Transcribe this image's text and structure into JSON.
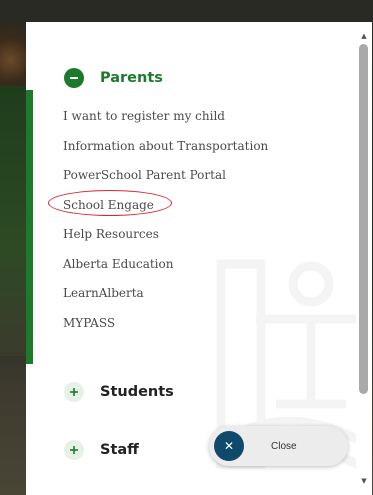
{
  "menu": {
    "parents": {
      "title": "Parents",
      "toggle_icon": "minus-circle-icon",
      "items": [
        {
          "label": "I want to register my child"
        },
        {
          "label": "Information about Transportation"
        },
        {
          "label": "PowerSchool Parent Portal"
        },
        {
          "label": "School Engage",
          "circled": true
        },
        {
          "label": "Help Resources"
        },
        {
          "label": "Alberta Education"
        },
        {
          "label": "LearnAlberta"
        },
        {
          "label": "MYPASS"
        }
      ]
    },
    "students": {
      "title": "Students",
      "toggle_icon": "plus-circle-icon"
    },
    "staff": {
      "title": "Staff",
      "toggle_icon": "plus-circle-icon"
    }
  },
  "close_button": {
    "label": "Close",
    "icon": "close-icon"
  },
  "colors": {
    "accent_green": "#1d7a2c",
    "close_circle": "#0f4a6a",
    "highlight_red": "#d6262e",
    "item_text": "#4a4a4a"
  }
}
